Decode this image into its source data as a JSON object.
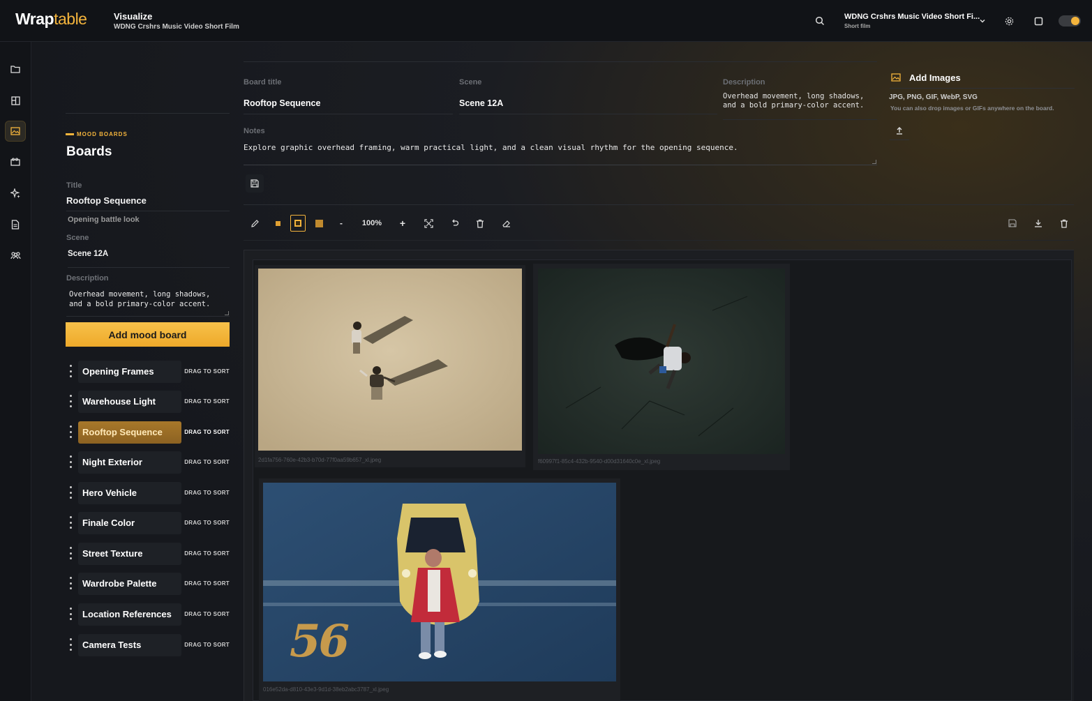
{
  "app": {
    "logo_bold": "Wrap",
    "logo_light": "table",
    "section": "Visualize",
    "project_subtitle": "WDNG Crshrs Music Video Short Film"
  },
  "project_switcher": {
    "name": "WDNG Crshrs Music Video Short Fi...",
    "type": "Short film"
  },
  "sidebar": {
    "eyebrow": "MOOD BOARDS",
    "heading": "Boards",
    "title_label": "Title",
    "title_value": "Rooftop Sequence",
    "subtitle_value": "Opening battle look",
    "scene_label": "Scene",
    "scene_value": "Scene 12A",
    "description_label": "Description",
    "description_value": "Overhead movement, long shadows, and a bold primary-color accent.",
    "add_button": "Add mood board",
    "drag_label": "DRAG TO SORT",
    "boards": [
      {
        "name": "Opening Frames"
      },
      {
        "name": "Warehouse Light"
      },
      {
        "name": "Rooftop Sequence"
      },
      {
        "name": "Night Exterior"
      },
      {
        "name": "Hero Vehicle"
      },
      {
        "name": "Finale Color"
      },
      {
        "name": "Street Texture"
      },
      {
        "name": "Wardrobe Palette"
      },
      {
        "name": "Location References"
      },
      {
        "name": "Camera Tests"
      }
    ],
    "active_board": "Rooftop Sequence"
  },
  "form": {
    "board_title_label": "Board title",
    "board_title_value": "Rooftop Sequence",
    "scene_label": "Scene",
    "scene_value": "Scene 12A",
    "description_label": "Description",
    "description_value": "Overhead movement, long shadows, and a bold primary-color accent.",
    "notes_label": "Notes",
    "notes_value": "Explore graphic overhead framing, warm practical light, and a clean visual rhythm for the opening sequence."
  },
  "add_images": {
    "title": "Add Images",
    "types": "JPG, PNG, GIF, WebP, SVG",
    "hint": "You can also drop images or GIFs anywhere on the board."
  },
  "toolbar": {
    "zoom_out": "-",
    "zoom": "100%",
    "zoom_in": "+",
    "swatch_colors": [
      "#e0a032",
      "#f4b43c",
      "#c08a2e"
    ]
  },
  "images": [
    {
      "filename": "2d1fa756-760e-42b3-b70d-77f0aa59b657_xl.jpeg",
      "scene": "two figures and long shadows on pale concrete, overhead"
    },
    {
      "filename": "f60997f1-85c4-432b-9540-d00d31640c0e_xl.jpeg",
      "scene": "figure lying on dark cracked asphalt with shadow, overhead"
    },
    {
      "filename": "016e52da-d810-43e3-9d1d-38eb2abc3787_xl.jpeg",
      "scene": "person in red jacket in front of yellow sports car on blue pavement",
      "painted_number": "56"
    }
  ]
}
